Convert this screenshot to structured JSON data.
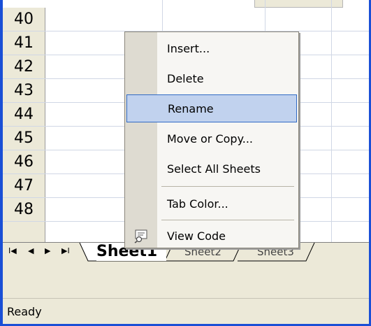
{
  "rows": [
    "40",
    "41",
    "42",
    "43",
    "44",
    "45",
    "46",
    "47",
    "48"
  ],
  "tabbar": {
    "nav": [
      "I◀",
      "◀",
      "▶",
      "▶I"
    ],
    "tabs": [
      "Sheet1",
      "Sheet2",
      "Sheet3"
    ]
  },
  "context_menu": {
    "items": [
      {
        "label": "Insert...",
        "hl": false
      },
      {
        "label": "Delete",
        "hl": false
      },
      {
        "label": "Rename",
        "hl": true
      },
      {
        "label": "Move or Copy...",
        "hl": false
      },
      {
        "label": "Select All Sheets",
        "hl": false
      },
      {
        "label": "Tab Color...",
        "hl": false
      },
      {
        "label": "View Code",
        "hl": false
      }
    ]
  },
  "status": {
    "text": "Ready"
  },
  "colors": {
    "frame": "#1a4fd6",
    "menu_highlight": "#c1d2ee",
    "chrome": "#ece9d8"
  }
}
